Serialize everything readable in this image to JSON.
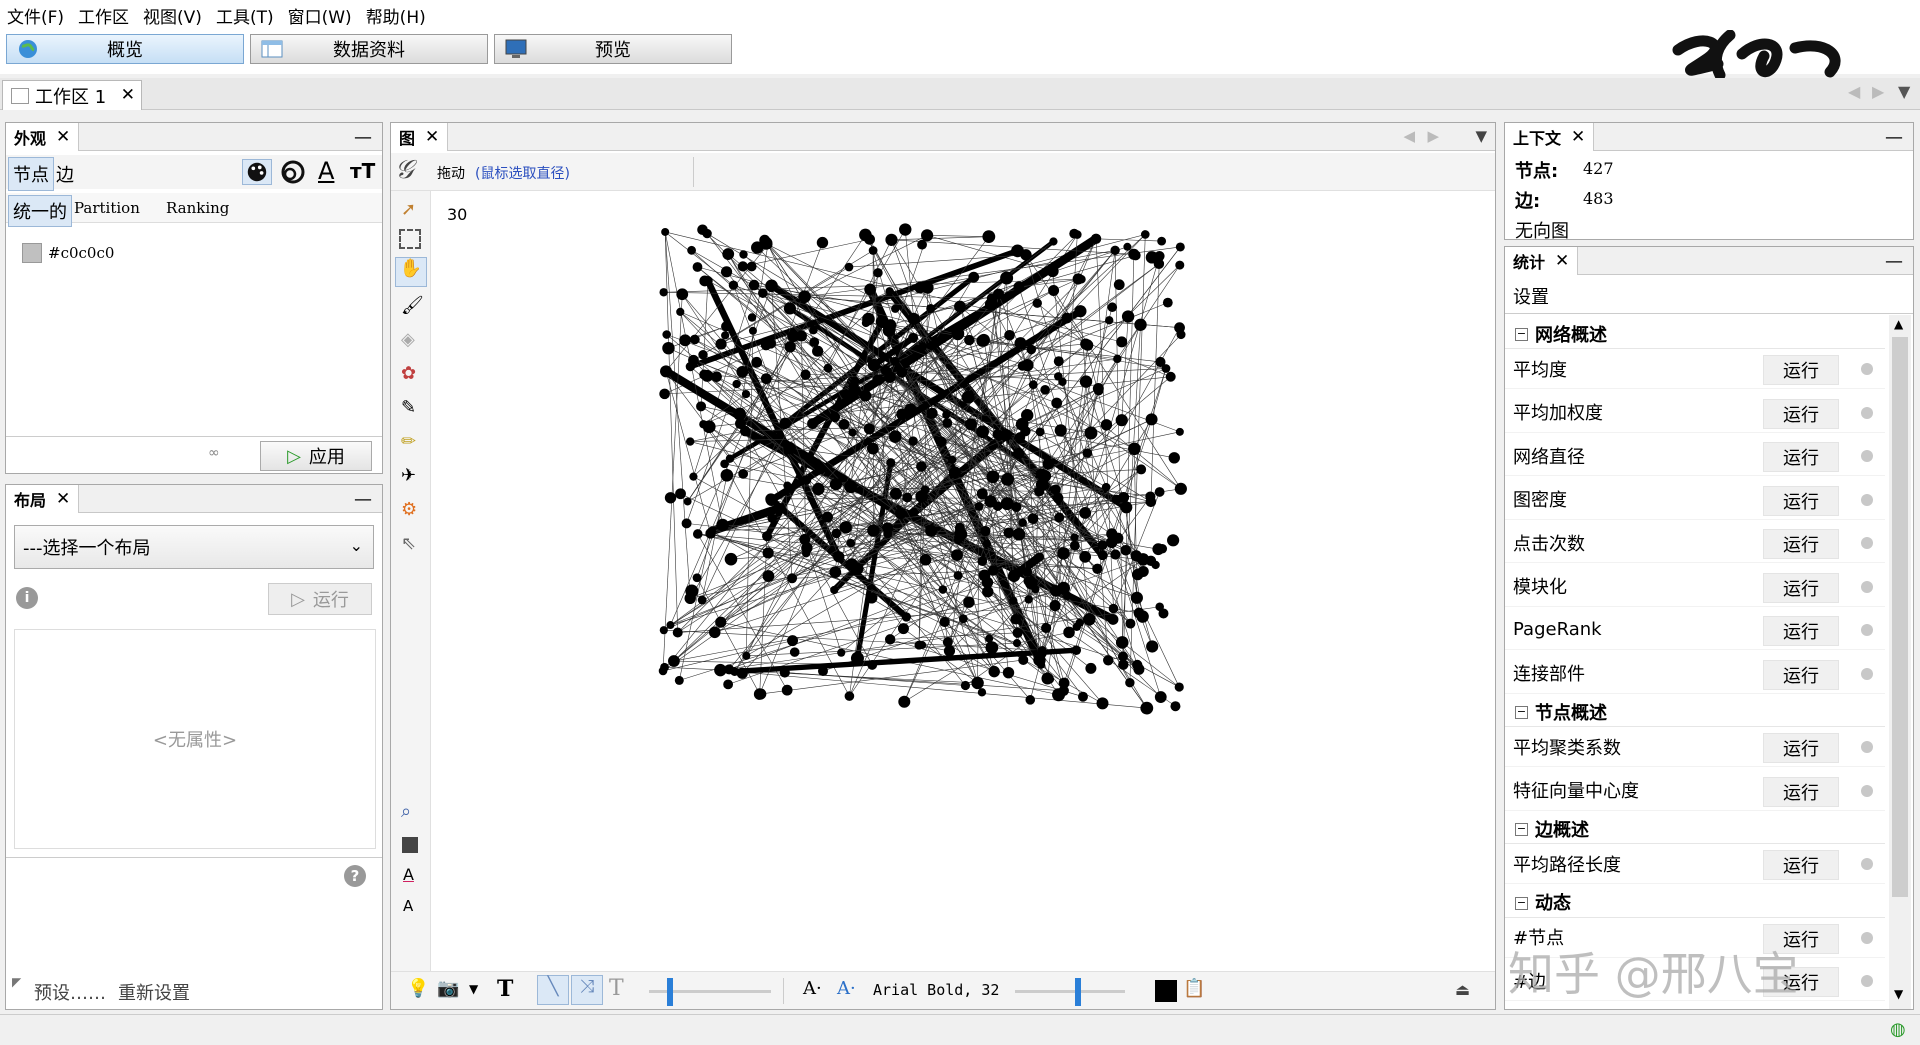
{
  "menu": [
    "文件(F)",
    "工作区",
    "视图(V)",
    "工具(T)",
    "窗口(W)",
    "帮助(H)"
  ],
  "modes": {
    "overview": "概览",
    "data": "数据资料",
    "preview": "预览"
  },
  "workspace_tab": {
    "label": "工作区 1",
    "close": "✕"
  },
  "appearance": {
    "title": "外观",
    "close": "✕",
    "tabs": [
      "节点",
      "边"
    ],
    "subtabs": [
      "统一的",
      "Partition",
      "Ranking"
    ],
    "color_value": "#c0c0c0",
    "swatch_color": "#c0c0c0",
    "apply": "应用"
  },
  "layout": {
    "title": "布局",
    "close": "✕",
    "select_placeholder": "---选择一个布局",
    "run": "运行",
    "no_properties": "<无属性>",
    "presets": "预设……",
    "reset": "重新设置"
  },
  "graph": {
    "title": "图",
    "close": "✕",
    "drag_label": "拖动",
    "drag_hint": "(鼠标选取直径)",
    "value": "30",
    "font_label": "Arial Bold, 32"
  },
  "context": {
    "title": "上下文",
    "close": "✕",
    "nodes_label": "节点:",
    "nodes_value": "427",
    "edges_label": "边:",
    "edges_value": "483",
    "graph_type": "无向图"
  },
  "stats": {
    "title": "统计",
    "close": "✕",
    "settings": "设置",
    "sections": [
      {
        "title": "网络概述",
        "items": [
          "平均度",
          "平均加权度",
          "网络直径",
          "图密度",
          "点击次数",
          "模块化",
          "PageRank",
          "连接部件"
        ]
      },
      {
        "title": "节点概述",
        "items": [
          "平均聚类系数",
          "特征向量中心度"
        ]
      },
      {
        "title": "边概述",
        "items": [
          "平均路径长度"
        ]
      },
      {
        "title": "动态",
        "items": [
          "#节点",
          "#边"
        ]
      }
    ],
    "run_label": "运行"
  },
  "watermark": "知乎 @邢八宝"
}
